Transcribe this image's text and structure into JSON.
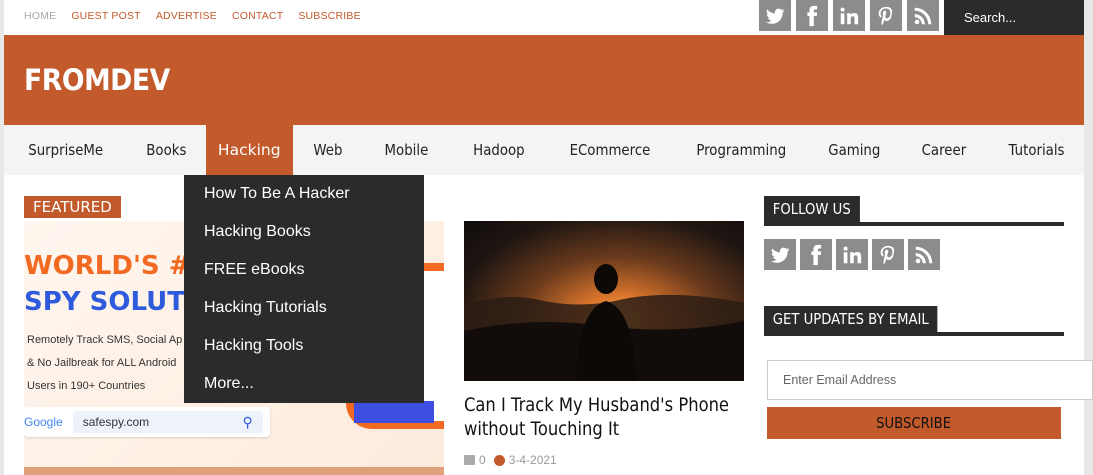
{
  "topbar": {
    "links": [
      "HOME",
      "GUEST POST",
      "ADVERTISE",
      "CONTACT",
      "SUBSCRIBE"
    ],
    "search_placeholder": "Search...",
    "social_icons": [
      "twitter-icon",
      "facebook-icon",
      "linkedin-icon",
      "pinterest-icon",
      "rss-icon"
    ]
  },
  "header": {
    "logo": "FROMDEV",
    "color": "#c25a2c"
  },
  "nav": {
    "items": [
      "SurpriseMe",
      "Books",
      "Hacking",
      "Web",
      "Mobile",
      "Hadoop",
      "ECommerce",
      "Programming",
      "Gaming",
      "Career",
      "Tutorials"
    ],
    "active": "Hacking"
  },
  "dropdown": {
    "items": [
      "How To Be A Hacker",
      "Hacking Books",
      "FREE eBooks",
      "Hacking Tutorials",
      "Hacking Tools",
      "More..."
    ]
  },
  "featured": {
    "label": "FEATURED",
    "ad": {
      "line1": "WORLD'S #",
      "line2": "SPY SOLUTI",
      "text1": "Remotely Track SMS, Social Ap",
      "text2": "& No Jailbreak for ALL Android",
      "text3": "Users in 190+ Countries",
      "google": "Google",
      "url": "safespy.com"
    }
  },
  "article": {
    "title": "Can I Track My Husband's Phone without Touching It",
    "comments": "0",
    "date": "3-4-2021"
  },
  "sidebar": {
    "follow_title": "FOLLOW US",
    "updates_title": "GET UPDATES BY EMAIL",
    "email_placeholder": "Enter Email Address",
    "subscribe_label": "SUBSCRIBE"
  }
}
